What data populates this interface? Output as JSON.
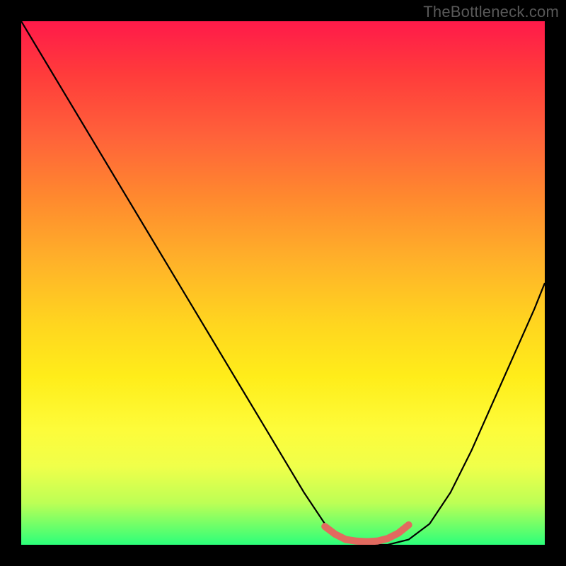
{
  "attribution": "TheBottleneck.com",
  "chart_data": {
    "type": "line",
    "title": "",
    "xlabel": "",
    "ylabel": "",
    "xlim": [
      0,
      100
    ],
    "ylim": [
      0,
      100
    ],
    "series": [
      {
        "name": "bottleneck-curve",
        "color": "#000000",
        "x": [
          0,
          6,
          12,
          18,
          24,
          30,
          36,
          42,
          48,
          54,
          58,
          62,
          66,
          70,
          74,
          78,
          82,
          86,
          90,
          94,
          98,
          100
        ],
        "y": [
          100,
          90,
          80,
          70,
          60,
          50,
          40,
          30,
          20,
          10,
          4,
          1,
          0,
          0,
          1,
          4,
          10,
          18,
          27,
          36,
          45,
          50
        ]
      },
      {
        "name": "optimal-marker",
        "color": "#e26a5f",
        "x": [
          58,
          60,
          62,
          64,
          66,
          68,
          70,
          72,
          74
        ],
        "y": [
          3.5,
          2,
          1,
          0.7,
          0.6,
          0.7,
          1.2,
          2.2,
          3.8
        ]
      }
    ],
    "background_gradient": {
      "top": "#ff1a4a",
      "mid": "#ffd61f",
      "bottom": "#2cff7a"
    }
  }
}
